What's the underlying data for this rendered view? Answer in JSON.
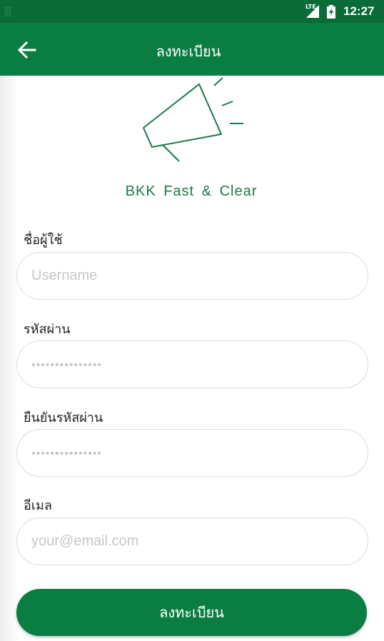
{
  "status_bar": {
    "network": "LTE",
    "time": "12:27",
    "color": "#0a6a38"
  },
  "app_bar": {
    "title": "ลงทะเบียน",
    "back_icon": "arrow-left-icon",
    "color": "#0a7d42"
  },
  "brand": {
    "icon": "megaphone-icon",
    "tagline": "BKK Fast & Clear",
    "color": "#1a7a4a"
  },
  "form": {
    "username": {
      "label": "ชื่อผู้ใช้",
      "placeholder": "Username",
      "value": ""
    },
    "password": {
      "label": "รหัสผ่าน",
      "placeholder": "•••••••••••••••",
      "value": ""
    },
    "confirm_password": {
      "label": "ยืนยันรหัสผ่าน",
      "placeholder": "•••••••••••••••",
      "value": ""
    },
    "email": {
      "label": "อีเมล",
      "placeholder": "your@email.com",
      "value": ""
    },
    "submit_label": "ลงทะเบียน"
  }
}
